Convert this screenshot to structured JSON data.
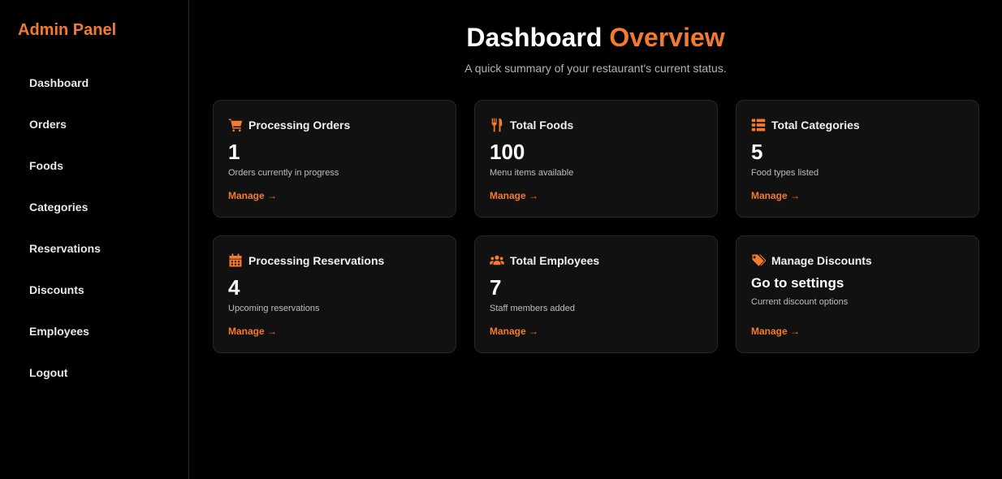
{
  "sidebar": {
    "brand": "Admin Panel",
    "items": [
      {
        "label": "Dashboard"
      },
      {
        "label": "Orders"
      },
      {
        "label": "Foods"
      },
      {
        "label": "Categories"
      },
      {
        "label": "Reservations"
      },
      {
        "label": "Discounts"
      },
      {
        "label": "Employees"
      },
      {
        "label": "Logout"
      }
    ]
  },
  "header": {
    "title_main": "Dashboard",
    "title_accent": "Overview",
    "subtitle": "A quick summary of your restaurant's current status."
  },
  "colors": {
    "accent": "#f47a2f",
    "background": "#000000",
    "card_background": "#111111"
  },
  "cards": [
    {
      "icon": "shopping-cart-icon",
      "title": "Processing Orders",
      "value": "1",
      "description": "Orders currently in progress",
      "link": "Manage →"
    },
    {
      "icon": "utensils-icon",
      "title": "Total Foods",
      "value": "100",
      "description": "Menu items available",
      "link": "Manage →"
    },
    {
      "icon": "list-icon",
      "title": "Total Categories",
      "value": "5",
      "description": "Food types listed",
      "link": "Manage →"
    },
    {
      "icon": "calendar-icon",
      "title": "Processing Reservations",
      "value": "4",
      "description": "Upcoming reservations",
      "link": "Manage →"
    },
    {
      "icon": "users-icon",
      "title": "Total Employees",
      "value": "7",
      "description": "Staff members added",
      "link": "Manage →"
    },
    {
      "icon": "tags-icon",
      "title": "Manage Discounts",
      "value": "Go to settings",
      "description": "Current discount options",
      "link": "Manage →"
    }
  ]
}
